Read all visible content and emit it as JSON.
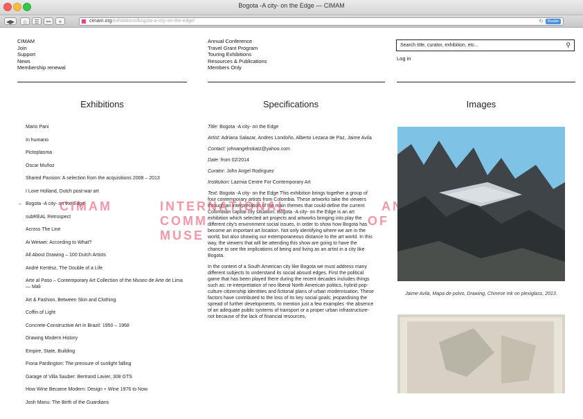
{
  "window": {
    "title": "Bogota -A city- on the Edge — CIMAM",
    "url_domain": "cimam.org",
    "url_path": "/exhibitions/bogota-a-city-on-the-edge/",
    "reader_label": "Reader"
  },
  "nav_primary": [
    "CIMAM",
    "Join",
    "Support",
    "News",
    "Membership renewal"
  ],
  "nav_secondary": [
    "Annual Conference",
    "Travel Grant Program",
    "Touring Exhibitions",
    "Resources & Publications",
    "Members Only"
  ],
  "search": {
    "placeholder": "Search title, curator, exhibition, etc..."
  },
  "login_label": "Log in",
  "columns": {
    "exhibitions": "Exhibitions",
    "specifications": "Specifications",
    "images": "Images"
  },
  "exhibitions": [
    "Mario Pani",
    "In humano",
    "Pictoplasma",
    "Oscar Muñoz",
    "Shared Passion: A selection from the acquisitions 2008 – 2013",
    "I Love Holland, Dutch post-war art",
    "Bogota -A city- on the Edge",
    "subREAL Retrospect",
    "Across The Line",
    "Ai Weiwei: According to What?",
    "All About Drawing – 100 Dutch Artists",
    "André Kertész, The Double of a Life",
    "Arte al Paso – Contemporary Art Collection of the Museo de Arte de Lima — Mali",
    "Art & Fashion. Between Skin and Clothing",
    "Coffin of Light",
    "Concrete-Constructive Art in Brazil: 1950 – 1968",
    "Drawing Modern History",
    "Empire, State, Building",
    "Fiona Pardington: The pressure of sunlight falling",
    "Garage of Villa Sauber: Bertrand Lavier, 308 GTS",
    "How Wine Became Modern: Design + Wine 1976 to Now",
    "Josh Manu: The Birth of the Guardians"
  ],
  "active_exhibition_index": 6,
  "specs": {
    "title_label": "Title:",
    "title": "Bogota -A city- on the Edge",
    "artist_label": "Artist:",
    "artist": "Adriana Salazar, Andres Londoño, Alberto Lezaca de Paz, Jaime Avila",
    "contact_label": "Contact:",
    "contact": "johnangelrokatz@yahoo.com",
    "date_label": "Date:",
    "date": "from 02/2014",
    "curator_label": "Curator:",
    "curator": "John Angel Rodriguez",
    "institution_label": "Institution:",
    "institution": "Lazmia Centre For Contemporary Art",
    "text_label": "Text:",
    "text_p1": "Bogota -A city- on the Edge This exhibition brings together a group of four contemporary artists from Colombia. These artworks take the viewers through an interpretation of the main themes that could define the current Colombian capital city situation. Bogota -A city- on the Edge is an art exhibition which selected art projects and artworks bringing into play the different city's environment social issues, in order to show how Bogota has become an important art location. Not only identifying where we are in the world, but also showing our extemporaneous distance to the art world. In this way, the viewers that will be attending this show are going to have the chance to see the implications of being and living as an artist in a city like Bogota.",
    "text_p2": "In the context of a South American city like Bogota we must address many different subjects to understand its social absurd edges. First the political game that has been played there during the recent decades includes things such as: re-interpretation of neo liberal North American politics, hybrid pop-culture citizenship identities and fictional plans of urban modernisation. These factors have contributed to the loss of its key social goals; jeopardising the spread of further developments, to mention just a few examples -the absence of an adequate public systems of transport or a proper urban infrastructure- not because of the lack of financial resources,"
  },
  "watermark": {
    "line1": [
      "CIMAM",
      "INTERNATIONAL",
      "AN"
    ],
    "line2": [
      "COMM",
      "OF"
    ],
    "line3": [
      "MUSE"
    ]
  },
  "images": {
    "caption": "Jaime Avila, Mapa de polvo, Drawing, Chinese Ink on plexiglass, 2013."
  },
  "colors": {
    "accent": "#e9415f",
    "text": "#222222",
    "sky": "#7ec3e6"
  }
}
